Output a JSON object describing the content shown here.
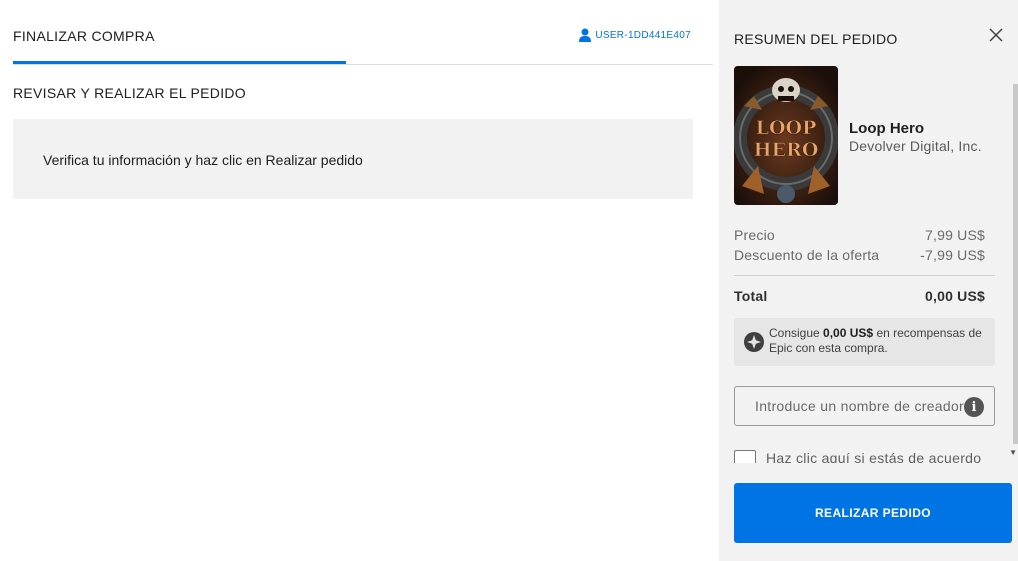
{
  "header": {
    "tab_label": "FINALIZAR COMPRA",
    "user_label": "USER-1DD441E407",
    "accent_color": "#0074e4"
  },
  "main": {
    "section_title": "REVISAR Y REALIZAR EL PEDIDO",
    "info_text": "Verifica tu información y haz clic en Realizar pedido"
  },
  "summary": {
    "title": "RESUMEN DEL PEDIDO",
    "close_icon": "close-icon",
    "game": {
      "title": "Loop Hero",
      "publisher": "Devolver Digital, Inc.",
      "cover_logo": "Loop Hero"
    },
    "price_label": "Precio",
    "price_value": "7,99 US$",
    "discount_label": "Descuento de la oferta",
    "discount_value": "-7,99 US$",
    "total_label": "Total",
    "total_value": "0,00 US$",
    "rewards": {
      "prefix": "Consigue",
      "amount": "0,00 US$",
      "suffix": "en recompensas de Epic con esta compra."
    },
    "creator_placeholder": "Introduce un nombre de creador",
    "agree_text": "Haz clic aquí si estás de acuerdo",
    "place_order_label": "REALIZAR PEDIDO"
  }
}
